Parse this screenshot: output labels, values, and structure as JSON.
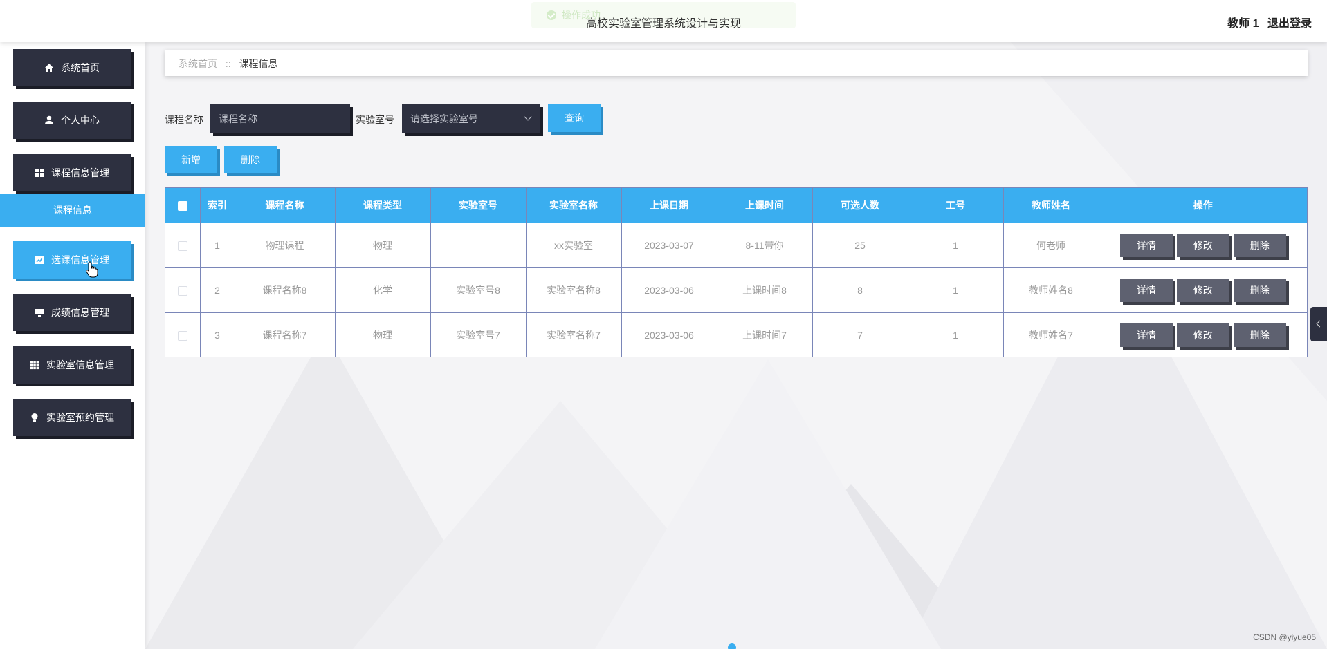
{
  "header": {
    "title": "高校实验室管理系统设计与实现",
    "user": "教师 1",
    "logout": "退出登录",
    "toast": "操作成功"
  },
  "sidebar": {
    "items": [
      {
        "label": "系统首页",
        "icon": "home-icon"
      },
      {
        "label": "个人中心",
        "icon": "user-icon"
      },
      {
        "label": "课程信息管理",
        "icon": "grid-icon"
      },
      {
        "label": "选课信息管理",
        "icon": "chart-icon"
      },
      {
        "label": "成绩信息管理",
        "icon": "monitor-icon"
      },
      {
        "label": "实验室信息管理",
        "icon": "table-icon"
      },
      {
        "label": "实验室预约管理",
        "icon": "bulb-icon"
      }
    ],
    "submenu": {
      "label": "课程信息"
    }
  },
  "breadcrumb": {
    "home": "系统首页",
    "separator": "::",
    "current": "课程信息"
  },
  "search": {
    "course_label": "课程名称",
    "course_placeholder": "课程名称",
    "lab_label": "实验室号",
    "lab_placeholder": "请选择实验室号",
    "query_button": "查询"
  },
  "actions": {
    "add": "新增",
    "delete": "删除"
  },
  "table": {
    "headers": [
      "索引",
      "课程名称",
      "课程类型",
      "实验室号",
      "实验室名称",
      "上课日期",
      "上课时间",
      "可选人数",
      "工号",
      "教师姓名",
      "操作"
    ],
    "rows": [
      [
        "1",
        "物理课程",
        "物理",
        "",
        "xx实验室",
        "2023-03-07",
        "8-11带你",
        "25",
        "1",
        "何老师"
      ],
      [
        "2",
        "课程名称8",
        "化学",
        "实验室号8",
        "实验室名称8",
        "2023-03-06",
        "上课时间8",
        "8",
        "1",
        "教师姓名8"
      ],
      [
        "3",
        "课程名称7",
        "物理",
        "实验室号7",
        "实验室名称7",
        "2023-03-06",
        "上课时间7",
        "7",
        "1",
        "教师姓名7"
      ]
    ],
    "row_actions": {
      "detail": "详情",
      "edit": "修改",
      "delete": "删除"
    }
  },
  "watermark": "CSDN @yiyue05",
  "colors": {
    "accent": "#3aaef0",
    "dark": "#2d3040",
    "action": "#5e6170",
    "border": "#7a86b8"
  }
}
